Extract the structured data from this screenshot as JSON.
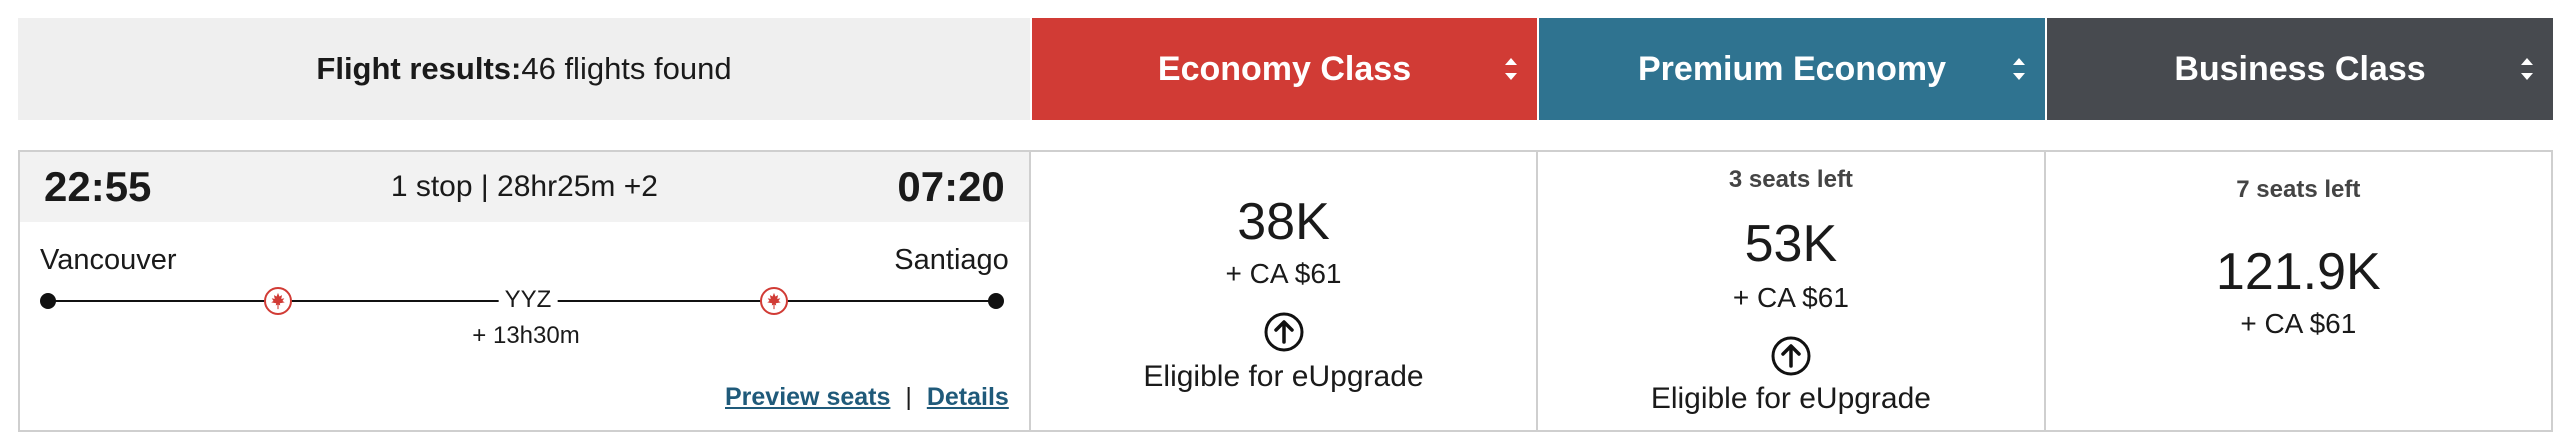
{
  "header": {
    "results_label": "Flight results:",
    "results_count": "46 flights found",
    "tabs": [
      {
        "label": "Economy Class",
        "color": "#d13b35"
      },
      {
        "label": "Premium Economy",
        "color": "#2f7390"
      },
      {
        "label": "Business Class",
        "color": "#474a4f"
      }
    ]
  },
  "flight": {
    "departure_time": "22:55",
    "arrival_time": "07:20",
    "summary": "1 stop | 28hr25m +2",
    "origin": "Vancouver",
    "destination": "Santiago",
    "connection_airport": "YYZ",
    "layover": "+ 13h30m",
    "links": {
      "preview_seats": "Preview seats",
      "separator": "|",
      "details": "Details"
    }
  },
  "fares": {
    "economy": {
      "points": "38K",
      "cash": "+  CA $61",
      "upgrade": "Eligible for eUpgrade"
    },
    "premium": {
      "seats": "3 seats left",
      "points": "53K",
      "cash": "+  CA $61",
      "upgrade": "Eligible for eUpgrade"
    },
    "business": {
      "seats": "7 seats left",
      "points": "121.9K",
      "cash": "+  CA $61"
    }
  }
}
